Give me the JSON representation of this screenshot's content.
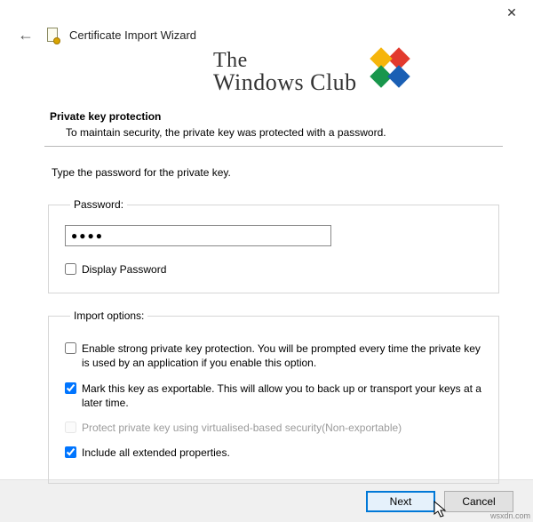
{
  "window": {
    "title": "Certificate Import Wizard"
  },
  "watermark": {
    "line1": "The",
    "line2": "Windows Club"
  },
  "section": {
    "title": "Private key protection",
    "description": "To maintain security, the private key was protected with a password."
  },
  "instruction": "Type the password for the private key.",
  "password": {
    "legend": "Password:",
    "value": "●●●●",
    "display_label": "Display Password",
    "display_checked": false
  },
  "options": {
    "legend": "Import options:",
    "opt1": {
      "checked": false,
      "label": "Enable strong private key protection. You will be prompted every time the private key is used by an application if you enable this option."
    },
    "opt2": {
      "checked": true,
      "label": "Mark this key as exportable. This will allow you to back up or transport your keys at a later time."
    },
    "opt3": {
      "checked": false,
      "disabled": true,
      "label": "Protect private key using virtualised-based security(Non-exportable)"
    },
    "opt4": {
      "checked": true,
      "label": "Include all extended properties."
    }
  },
  "buttons": {
    "next": "Next",
    "cancel": "Cancel"
  },
  "source": "wsxdn.com"
}
